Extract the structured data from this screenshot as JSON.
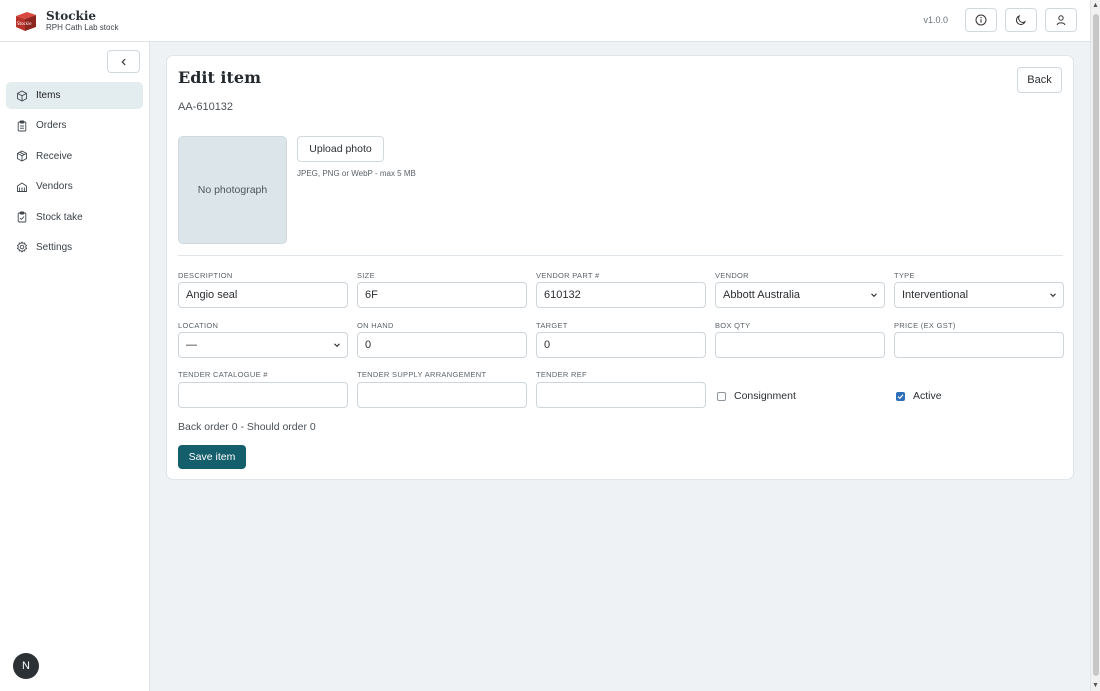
{
  "app": {
    "name": "Stockie",
    "subtitle": "RPH Cath Lab stock",
    "logo_text": "Stockie",
    "version": "v1.0.0"
  },
  "header_buttons": {
    "info": "info-icon",
    "theme": "moon-icon",
    "user": "user-icon"
  },
  "sidebar": {
    "collapse_icon": "chevron-left-icon",
    "items": [
      {
        "label": "Items",
        "icon": "box-icon",
        "active": true
      },
      {
        "label": "Orders",
        "icon": "clipboard-icon",
        "active": false
      },
      {
        "label": "Receive",
        "icon": "package-icon",
        "active": false
      },
      {
        "label": "Vendors",
        "icon": "building-icon",
        "active": false
      },
      {
        "label": "Stock take",
        "icon": "clipboard-check-icon",
        "active": false
      },
      {
        "label": "Settings",
        "icon": "gear-icon",
        "active": false
      }
    ],
    "avatar_initial": "N"
  },
  "page": {
    "title": "Edit item",
    "item_code": "AA-610132",
    "back_label": "Back",
    "photo_placeholder": "No photograph",
    "upload_label": "Upload photo",
    "upload_hint": "JPEG, PNG or WebP - max 5 MB",
    "fields": {
      "description": {
        "label": "Description",
        "value": "Angio seal"
      },
      "size": {
        "label": "Size",
        "value": "6F"
      },
      "vendor_part": {
        "label": "Vendor part #",
        "value": "610132"
      },
      "vendor": {
        "label": "Vendor",
        "value": "Abbott Australia"
      },
      "type": {
        "label": "Type",
        "value": "Interventional"
      },
      "location": {
        "label": "Location",
        "value": "—"
      },
      "on_hand": {
        "label": "On hand",
        "value": "0"
      },
      "target": {
        "label": "Target",
        "value": "0"
      },
      "box_qty": {
        "label": "Box qty",
        "value": ""
      },
      "price": {
        "label": "Price (ex GST)",
        "value": ""
      },
      "tender_catalogue": {
        "label": "Tender catalogue #",
        "value": ""
      },
      "tender_supply": {
        "label": "Tender supply arrangement",
        "value": ""
      },
      "tender_ref": {
        "label": "Tender ref",
        "value": ""
      }
    },
    "consignment": {
      "label": "Consignment",
      "checked": false
    },
    "active": {
      "label": "Active",
      "checked": true
    },
    "order_note": "Back order 0 - Should order 0",
    "save_label": "Save item"
  },
  "colors": {
    "primary": "#155e6c",
    "logo": "#b7322b",
    "background": "#eef2f4"
  }
}
